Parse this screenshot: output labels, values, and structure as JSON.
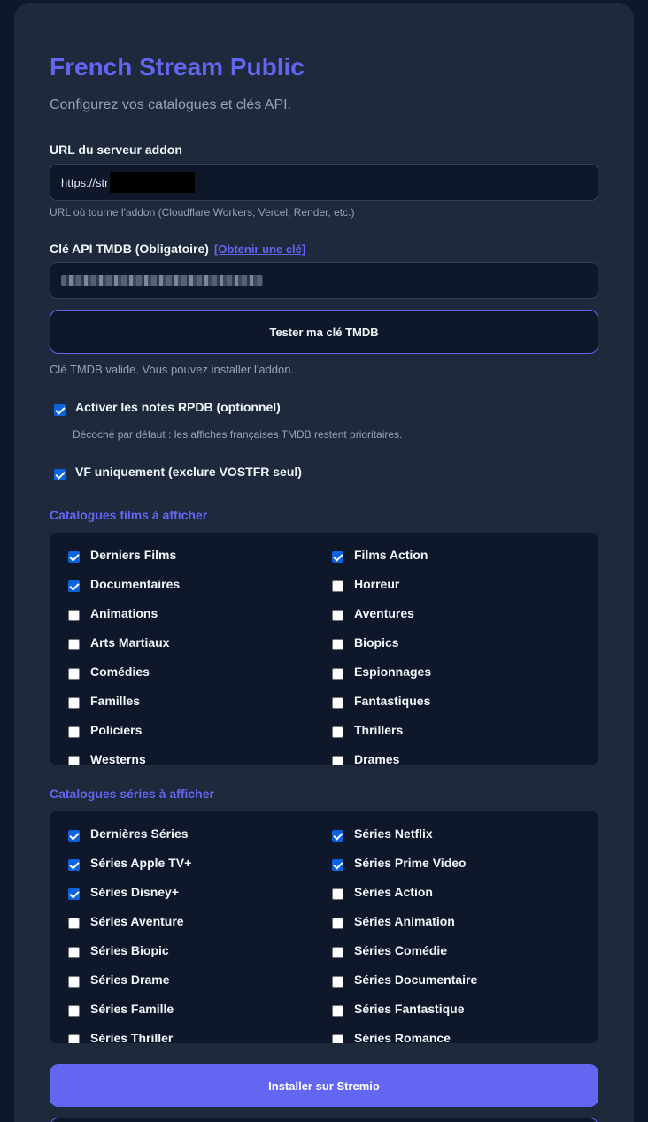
{
  "app": {
    "title": "French Stream Public",
    "subtitle": "Configurez vos catalogues et clés API."
  },
  "server": {
    "label": "URL du serveur addon",
    "value": "https://str",
    "hint": "URL où tourne l'addon (Cloudflare Workers, Vercel, Render, etc.)"
  },
  "tmdb": {
    "label": "Clé API TMDB (Obligatoire)",
    "link_label": "[Obtenir une clé]",
    "test_button": "Tester ma clé TMDB",
    "status": "Clé TMDB valide. Vous pouvez installer l'addon."
  },
  "options": {
    "rpdb": {
      "label": "Activer les notes RPDB (optionnel)",
      "checked": true,
      "hint": "Décoché par défaut : les affiches françaises TMDB restent prioritaires."
    },
    "vf": {
      "label": "VF uniquement (exclure VOSTFR seul)",
      "checked": true
    }
  },
  "films": {
    "title": "Catalogues films à afficher",
    "items": [
      {
        "label": "Derniers Films",
        "checked": true
      },
      {
        "label": "Films Action",
        "checked": true
      },
      {
        "label": "Documentaires",
        "checked": true
      },
      {
        "label": "Horreur",
        "checked": false
      },
      {
        "label": "Animations",
        "checked": false
      },
      {
        "label": "Aventures",
        "checked": false
      },
      {
        "label": "Arts Martiaux",
        "checked": false
      },
      {
        "label": "Biopics",
        "checked": false
      },
      {
        "label": "Comédies",
        "checked": false
      },
      {
        "label": "Espionnages",
        "checked": false
      },
      {
        "label": "Familles",
        "checked": false
      },
      {
        "label": "Fantastiques",
        "checked": false
      },
      {
        "label": "Policiers",
        "checked": false
      },
      {
        "label": "Thrillers",
        "checked": false
      },
      {
        "label": "Westerns",
        "checked": false
      },
      {
        "label": "Drames",
        "checked": false
      }
    ]
  },
  "series": {
    "title": "Catalogues séries à afficher",
    "items": [
      {
        "label": "Dernières Séries",
        "checked": true
      },
      {
        "label": "Séries Netflix",
        "checked": true
      },
      {
        "label": "Séries Apple TV+",
        "checked": true
      },
      {
        "label": "Séries Prime Video",
        "checked": true
      },
      {
        "label": "Séries Disney+",
        "checked": true
      },
      {
        "label": "Séries Action",
        "checked": false
      },
      {
        "label": "Séries Aventure",
        "checked": false
      },
      {
        "label": "Séries Animation",
        "checked": false
      },
      {
        "label": "Séries Biopic",
        "checked": false
      },
      {
        "label": "Séries Comédie",
        "checked": false
      },
      {
        "label": "Séries Drame",
        "checked": false
      },
      {
        "label": "Séries Documentaire",
        "checked": false
      },
      {
        "label": "Séries Famille",
        "checked": false
      },
      {
        "label": "Séries Fantastique",
        "checked": false
      },
      {
        "label": "Séries Thriller",
        "checked": false
      },
      {
        "label": "Séries Romance",
        "checked": false
      }
    ]
  },
  "install": {
    "label": "Installer sur Stremio"
  },
  "colors": {
    "accent": "#6366f1",
    "checkbox": "#0b63e0",
    "card": "#1e293b",
    "page": "#0f172a"
  }
}
